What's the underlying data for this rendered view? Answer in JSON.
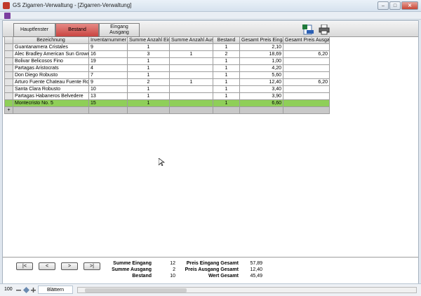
{
  "window": {
    "title": "GS Zigarren-Verwaltung - [Zigarren-Verwaltung]"
  },
  "nav": {
    "tab_main": "Hauptfenster",
    "tab_stock": "Bestand",
    "tab_inout_1": "Eingang",
    "tab_inout_2": "Ausgang"
  },
  "table": {
    "headers": [
      "Bezeichnung",
      "Inventarnummer",
      "Summe Anzahl Ein...",
      "Summe Anzahl Aus...",
      "Bestand",
      "Gesamt Preis Eingang",
      "Gesamt Preis Ausgang"
    ],
    "rows": [
      {
        "bez": "Guantanamera Cristales",
        "inv": "9",
        "se": "1",
        "sa": "",
        "bes": "1",
        "gpe": "2,10",
        "gpa": ""
      },
      {
        "bez": "Alec Bradley American Sun Grown",
        "inv": "16",
        "se": "3",
        "sa": "1",
        "bes": "2",
        "gpe": "18,69",
        "gpa": "6,20"
      },
      {
        "bez": "Bolivar Belicosos Fino",
        "inv": "19",
        "se": "1",
        "sa": "",
        "bes": "1",
        "gpe": "1,00",
        "gpa": ""
      },
      {
        "bez": "Partagas Aristocrats",
        "inv": "4",
        "se": "1",
        "sa": "",
        "bes": "1",
        "gpe": "4,20",
        "gpa": ""
      },
      {
        "bez": "Don Diego Robusto",
        "inv": "7",
        "se": "1",
        "sa": "",
        "bes": "1",
        "gpe": "5,60",
        "gpa": ""
      },
      {
        "bez": "Arturo Fuente Chateau Fuente Robusto",
        "inv": "9",
        "se": "2",
        "sa": "1",
        "bes": "1",
        "gpe": "12,40",
        "gpa": "6,20"
      },
      {
        "bez": "Santa Clara Robusto",
        "inv": "10",
        "se": "1",
        "sa": "",
        "bes": "1",
        "gpe": "3,40",
        "gpa": ""
      },
      {
        "bez": "Partagas Habaneros Belvedere",
        "inv": "13",
        "se": "1",
        "sa": "",
        "bes": "1",
        "gpe": "3,90",
        "gpa": ""
      },
      {
        "bez": "Montecristo No. 5",
        "inv": "15",
        "se": "1",
        "sa": "",
        "bes": "1",
        "gpe": "6,60",
        "gpa": ""
      }
    ]
  },
  "footer": {
    "nav_first": "|<",
    "nav_prev": "<",
    "nav_next": ">",
    "nav_last": ">|",
    "summe_eingang_label": "Summe Eingang",
    "summe_eingang": "12",
    "summe_ausgang_label": "Summe Ausgang",
    "summe_ausgang": "2",
    "bestand_label": "Bestand",
    "bestand": "10",
    "preis_eingang_label": "Preis Eingang Gesamt",
    "preis_eingang": "57,89",
    "preis_ausgang_label": "Preis Ausgang Gesamt",
    "preis_ausgang": "12,40",
    "wert_label": "Wert Gesamt",
    "wert": "45,49"
  },
  "status": {
    "zoom": "100",
    "mode": "Blättern"
  },
  "icons": [
    "app-icon",
    "export-xls-icon",
    "printer-icon",
    "record-selector-icon"
  ],
  "colors": {
    "active_tab": "#c94541",
    "selected_row": "#8fcf58"
  }
}
